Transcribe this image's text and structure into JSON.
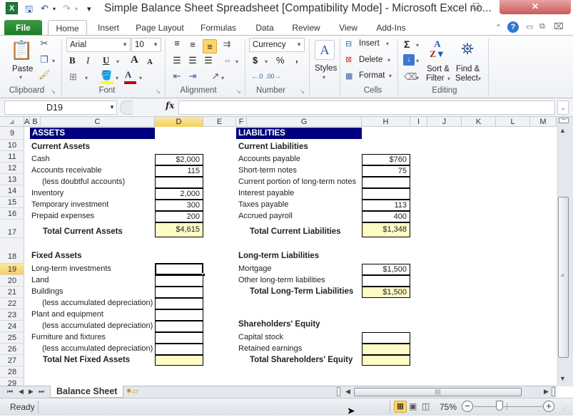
{
  "window": {
    "title": "Simple Balance Sheet Spreadsheet  [Compatibility Mode]  -  Microsoft Excel no...",
    "minimize": "–",
    "maximize": "☐",
    "close": "✕"
  },
  "quick_access": {
    "save": "save-icon",
    "undo": "undo-icon",
    "redo": "redo-icon",
    "customize": "▾"
  },
  "tabs": [
    "File",
    "Home",
    "Insert",
    "Page Layout",
    "Formulas",
    "Data",
    "Review",
    "View",
    "Add-Ins"
  ],
  "ribbon": {
    "clipboard": {
      "label": "Clipboard",
      "paste": "Paste"
    },
    "font": {
      "label": "Font",
      "name": "Arial",
      "size": "10",
      "bold": "B",
      "italic": "I",
      "underline": "U",
      "grow": "A",
      "shrink": "A",
      "font_color": "A",
      "fill_color": "#ffff00",
      "text_color": "#c00000"
    },
    "alignment": {
      "label": "Alignment"
    },
    "number": {
      "label": "Number",
      "format": "Currency",
      "currency": "$",
      "percent": "%",
      "comma": ","
    },
    "styles": {
      "label": "Styles"
    },
    "cells": {
      "label": "Cells",
      "insert": "Insert",
      "delete": "Delete",
      "format": "Format"
    },
    "editing": {
      "label": "Editing",
      "sum": "Σ",
      "sort": "Sort &",
      "sort2": "Filter",
      "find": "Find &",
      "find2": "Select"
    }
  },
  "formula_bar": {
    "name_box": "D19",
    "fx": "fx",
    "value": ""
  },
  "columns": [
    "A",
    "B",
    "C",
    "D",
    "E",
    "F",
    "G",
    "H",
    "I",
    "J",
    "K",
    "L",
    "M"
  ],
  "selected_column": "D",
  "selected_row": "19",
  "rows": [
    "9",
    "10",
    "11",
    "12",
    "13",
    "14",
    "15",
    "16",
    "17",
    "18",
    "19",
    "20",
    "21",
    "22",
    "23",
    "24",
    "25",
    "26",
    "27",
    "28",
    "29"
  ],
  "assets": {
    "header": "ASSETS",
    "current": {
      "title": "Current Assets",
      "items": [
        {
          "label": "Cash",
          "value": "$2,000"
        },
        {
          "label": "Accounts receivable",
          "value": "115"
        },
        {
          "label": "(less doubtful accounts)",
          "value": ""
        },
        {
          "label": "Inventory",
          "value": "2,000"
        },
        {
          "label": "Temporary investment",
          "value": "300"
        },
        {
          "label": "Prepaid expenses",
          "value": "200"
        }
      ],
      "total_label": "Total Current Assets",
      "total_value": "$4,615"
    },
    "fixed": {
      "title": "Fixed Assets",
      "items": [
        {
          "label": "Long-term investments",
          "value": ""
        },
        {
          "label": "Land",
          "value": ""
        },
        {
          "label": "Buildings",
          "value": ""
        },
        {
          "label": "(less accumulated depreciation)",
          "value": ""
        },
        {
          "label": "Plant and equipment",
          "value": ""
        },
        {
          "label": "(less accumulated depreciation)",
          "value": ""
        },
        {
          "label": "Furniture and fixtures",
          "value": ""
        },
        {
          "label": "(less accumulated depreciation)",
          "value": ""
        }
      ],
      "total_label": "Total Net Fixed Assets",
      "total_value": ""
    }
  },
  "liabilities": {
    "header": "LIABILITIES",
    "current": {
      "title": "Current Liabilities",
      "items": [
        {
          "label": "Accounts payable",
          "value": "$760"
        },
        {
          "label": "Short-term notes",
          "value": "75"
        },
        {
          "label": "Current portion of long-term notes",
          "value": ""
        },
        {
          "label": "Interest payable",
          "value": ""
        },
        {
          "label": "Taxes payable",
          "value": "113"
        },
        {
          "label": "Accrued payroll",
          "value": "400"
        }
      ],
      "total_label": "Total Current Liabilities",
      "total_value": "$1,348"
    },
    "longterm": {
      "title": "Long-term Liabilities",
      "items": [
        {
          "label": "Mortgage",
          "value": "$1,500"
        },
        {
          "label": "Other long-term liabilities",
          "value": ""
        }
      ],
      "total_label": "Total Long-Term Liabilities",
      "total_value": "$1,500"
    },
    "equity": {
      "title": "Shareholders' Equity",
      "items": [
        {
          "label": "Capital stock",
          "value": ""
        },
        {
          "label": "Retained earnings",
          "value": ""
        }
      ],
      "total_label": "Total Shareholders' Equity",
      "total_value": ""
    }
  },
  "sheet_tabs": {
    "active": "Balance Sheet"
  },
  "status": {
    "text": "Ready",
    "zoom": "75%"
  },
  "colors": {
    "header_fill": "#000080",
    "total_fill": "#fffbc6",
    "file_tab": "#2a8a31",
    "selection": "#f5cf61"
  }
}
